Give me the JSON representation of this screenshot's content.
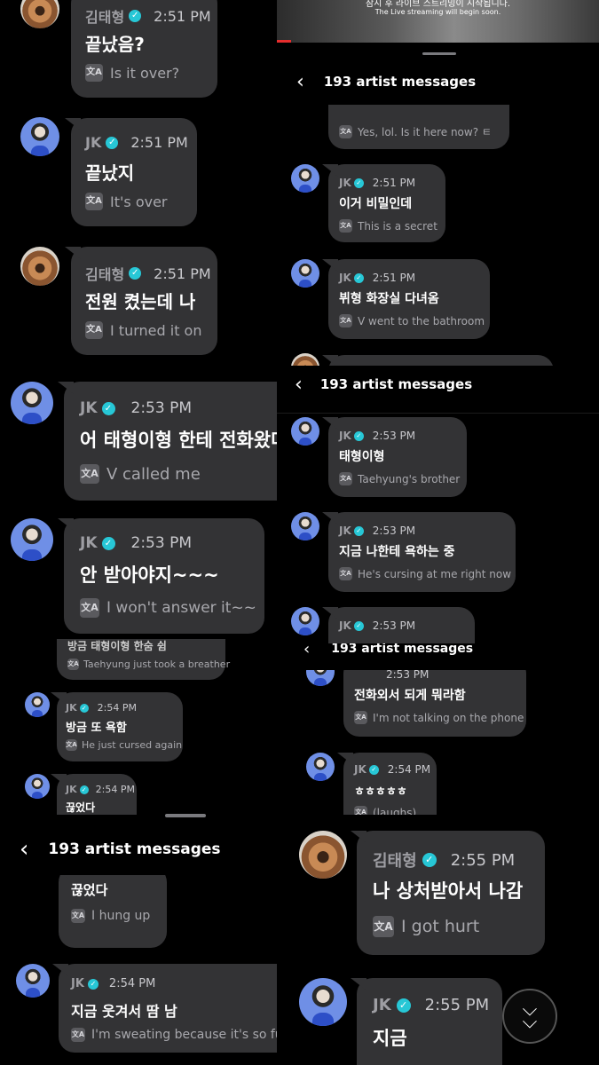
{
  "header_title": "193 artist messages",
  "video_caption_line1": "잠시 후 라이브 스트리밍이 시작됩니다.",
  "video_caption_line2": "The Live streaming will begin soon.",
  "icons": {
    "back": "chevron-left-icon",
    "verified": "verified-check-icon",
    "translate": "translate-icon",
    "scroll": "double-chevron-down-icon"
  },
  "colors": {
    "bubble": "#333335",
    "verified": "#27c7d6",
    "background": "#000000"
  },
  "messages": {
    "left_1": {
      "name": "김태형",
      "time": "2:51 PM",
      "text": "끝났음?",
      "translation": "Is it over?"
    },
    "left_2": {
      "name": "JK",
      "time": "2:51 PM",
      "text": "끝났지",
      "translation": "It's over"
    },
    "left_3": {
      "name": "김태형",
      "time": "2:51 PM",
      "text": "전원 켰는데 나",
      "translation": "I turned it on"
    },
    "left_4": {
      "name": "JK",
      "time": "2:53 PM",
      "text": "어 태형이형 한테 전화왔다",
      "translation": "V called me"
    },
    "left_5": {
      "name": "JK",
      "time": "2:53 PM",
      "text": "안 받아야지~~~",
      "translation": "I won't answer it~~"
    },
    "left_6": {
      "text": "방금 태형이형 한숨 쉼",
      "translation": "Taehyung just took a breather"
    },
    "left_7": {
      "name": "JK",
      "time": "2:54 PM",
      "text": "방금 또 욕함",
      "translation": "He just cursed again"
    },
    "left_8": {
      "name": "JK",
      "time": "2:54 PM",
      "text": "끊었다"
    },
    "left_9": {
      "text": "끊었다",
      "translation": "I hung up"
    },
    "left_10": {
      "name": "JK",
      "time": "2:54 PM",
      "text": "지금 웃겨서 땀 남",
      "translation": "I'm sweating because it's so funny"
    },
    "right_1": {
      "translation": "Yes, lol. Is it here now? ㅌ"
    },
    "right_2": {
      "name": "JK",
      "time": "2:51 PM",
      "text": "이거 비밀인데",
      "translation": "This is a secret"
    },
    "right_3": {
      "name": "JK",
      "time": "2:51 PM",
      "text": "뷔형 화장실 다녀옴",
      "translation": "V went to the bathroom"
    },
    "right_4": {
      "name": "JK",
      "time": "2:53 PM",
      "text": "태형이형",
      "translation": "Taehyung's brother"
    },
    "right_5": {
      "name": "JK",
      "time": "2:53 PM",
      "text": "지금 나한테 욕하는 중",
      "translation": "He's cursing at me right now"
    },
    "right_6": {
      "name": "JK",
      "time": "2:53 PM"
    },
    "right_7": {
      "time": "2:53 PM",
      "text": "전화외서 되게 뭐라함",
      "translation": "I'm not talking on the phone"
    },
    "right_8": {
      "name": "JK",
      "time": "2:54 PM",
      "text": "ㅎㅎㅎㅎㅎ",
      "translation": "(laughs)"
    },
    "right_9": {
      "name": "김태형",
      "time": "2:55 PM",
      "text": "나 상처받아서 나감",
      "translation": "I got hurt"
    },
    "right_10": {
      "name": "JK",
      "time": "2:55 PM",
      "text": "지금"
    }
  }
}
